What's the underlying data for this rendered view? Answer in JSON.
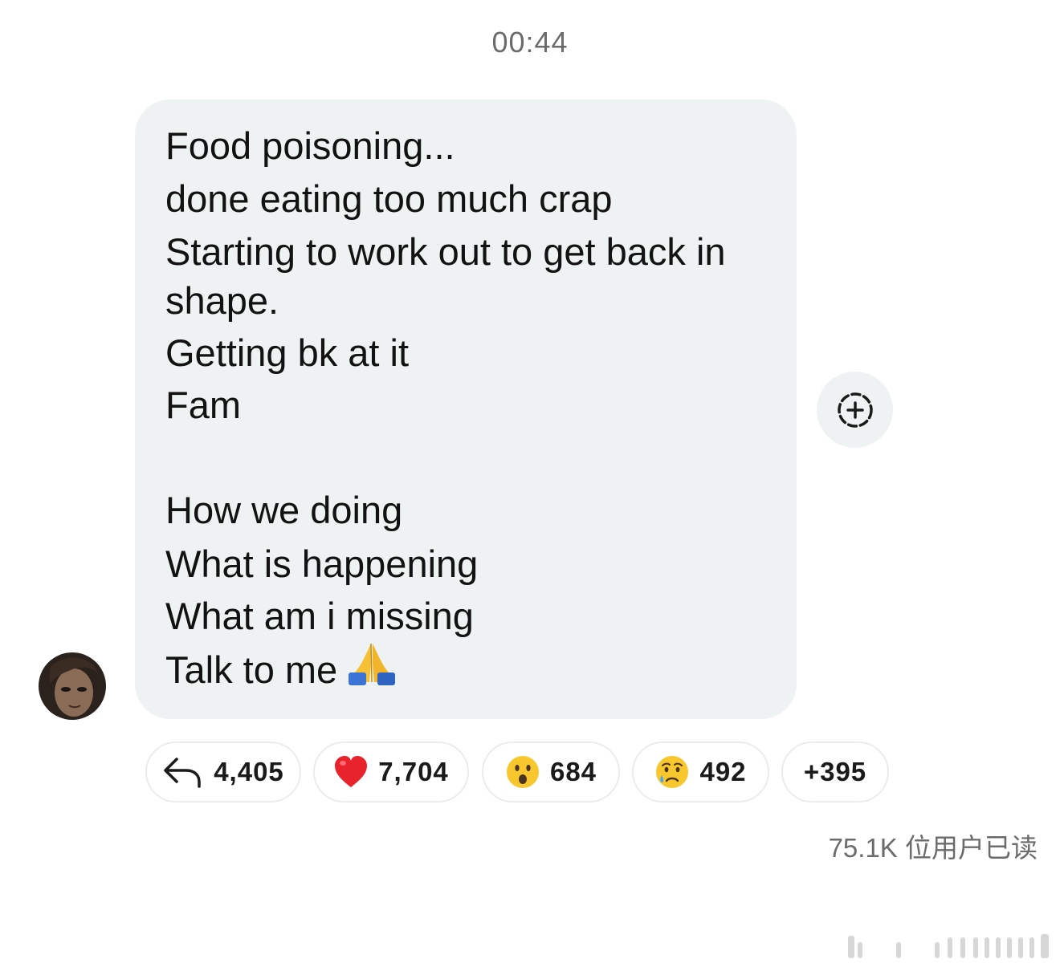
{
  "timestamp": "00:44",
  "message": {
    "lines": [
      "Food poisoning...",
      "done eating too much crap",
      "Starting to work out to get back in",
      "shape.",
      "Getting bk at it",
      "Fam",
      "",
      "How we doing",
      "What is happening",
      "What am i missing",
      "Talk to me"
    ],
    "trailing_emoji": "pray-emoji"
  },
  "reactions": [
    {
      "icon": "reply-arrow-icon",
      "count": "4,405"
    },
    {
      "icon": "red-heart-emoji",
      "count": "7,704"
    },
    {
      "icon": "surprised-face-emoji",
      "count": "684"
    },
    {
      "icon": "crying-face-emoji",
      "count": "492"
    },
    {
      "icon": "",
      "count": "+395"
    }
  ],
  "seen_by": "75.1K 位用户已读",
  "colors": {
    "bubble": "#eef2f2",
    "meta_text": "#6b6b6b",
    "pill_border": "#ececec",
    "heart": "#e8232b",
    "emoji_face": "#f8c62d"
  }
}
